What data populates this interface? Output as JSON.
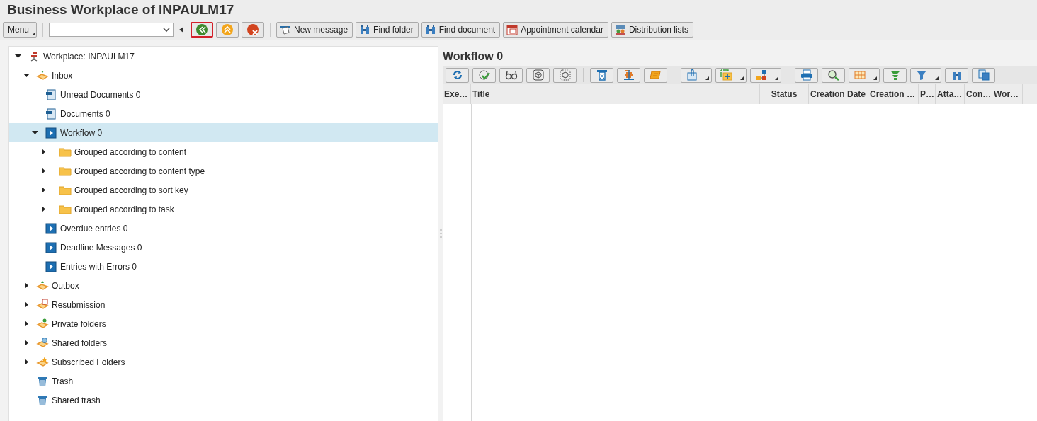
{
  "window": {
    "title": "Business Workplace of INPAULM17"
  },
  "toolbar": {
    "menu": "Menu",
    "nav_buttons": [
      {
        "kind": "back",
        "highlighted": true
      },
      {
        "kind": "up",
        "highlighted": false
      },
      {
        "kind": "cancel",
        "highlighted": false
      }
    ],
    "buttons": [
      {
        "kind": "message",
        "label": "New message"
      },
      {
        "kind": "binoculars",
        "label": "Find folder"
      },
      {
        "kind": "binoculars",
        "label": "Find document"
      },
      {
        "kind": "calendar",
        "label": "Appointment calendar"
      },
      {
        "kind": "people",
        "label": "Distribution lists"
      }
    ]
  },
  "tree": [
    {
      "label": "Workplace: INPAULM17",
      "kind": "workplace",
      "expanded": true,
      "selected": false,
      "children": [
        {
          "label": "Inbox",
          "kind": "inbox",
          "expanded": true,
          "selected": false,
          "children": [
            {
              "label": "Unread Documents 0",
              "kind": "document",
              "selected": false
            },
            {
              "label": "Documents 0",
              "kind": "document",
              "selected": false
            },
            {
              "label": "Workflow 0",
              "kind": "workflow",
              "expanded": true,
              "selected": true,
              "children": [
                {
                  "label": "Grouped according to content",
                  "kind": "folder",
                  "expanded": false,
                  "selected": false
                },
                {
                  "label": "Grouped according to content type",
                  "kind": "folder",
                  "expanded": false,
                  "selected": false
                },
                {
                  "label": "Grouped according to sort key",
                  "kind": "folder",
                  "expanded": false,
                  "selected": false
                },
                {
                  "label": "Grouped according to task",
                  "kind": "folder",
                  "expanded": false,
                  "selected": false
                }
              ]
            },
            {
              "label": "Overdue entries 0",
              "kind": "workflow",
              "selected": false
            },
            {
              "label": "Deadline Messages 0",
              "kind": "workflow",
              "selected": false
            },
            {
              "label": "Entries with Errors 0",
              "kind": "workflow",
              "selected": false
            }
          ]
        },
        {
          "label": "Outbox",
          "kind": "outbox",
          "expanded": false,
          "selected": false
        },
        {
          "label": "Resubmission",
          "kind": "resubmission",
          "expanded": false,
          "selected": false
        },
        {
          "label": "Private folders",
          "kind": "private",
          "expanded": false,
          "selected": false
        },
        {
          "label": "Shared folders",
          "kind": "shared",
          "expanded": false,
          "selected": false
        },
        {
          "label": "Subscribed Folders",
          "kind": "subscribed",
          "expanded": false,
          "selected": false
        },
        {
          "label": "Trash",
          "kind": "trash",
          "selected": false
        },
        {
          "label": "Shared trash",
          "kind": "trash",
          "selected": false
        }
      ]
    }
  ],
  "content": {
    "title": "Workflow 0",
    "tool_groups": [
      [
        {
          "kind": "refresh",
          "dropdown": false
        },
        {
          "kind": "execute",
          "dropdown": false
        },
        {
          "kind": "glasses",
          "dropdown": false
        },
        {
          "kind": "cube",
          "dropdown": false
        },
        {
          "kind": "cube-dotted",
          "dropdown": false
        }
      ],
      [
        {
          "kind": "forward",
          "dropdown": false
        },
        {
          "kind": "align",
          "dropdown": false
        },
        {
          "kind": "scroll",
          "dropdown": false
        }
      ],
      [
        {
          "kind": "attach",
          "dropdown": true
        },
        {
          "kind": "add-folder",
          "dropdown": true
        },
        {
          "kind": "blocks",
          "dropdown": true
        }
      ],
      [
        {
          "kind": "print",
          "dropdown": false
        },
        {
          "kind": "zoom",
          "dropdown": false
        },
        {
          "kind": "grid",
          "dropdown": true
        },
        {
          "kind": "sum",
          "dropdown": false
        },
        {
          "kind": "filter",
          "dropdown": true
        },
        {
          "kind": "binoculars",
          "dropdown": false
        },
        {
          "kind": "copy",
          "dropdown": false
        }
      ]
    ],
    "columns": [
      "Exe…",
      "Title",
      "Status",
      "Creation Date",
      "Creation …",
      "P…",
      "Atta…",
      "Con…",
      "Wor…"
    ]
  }
}
